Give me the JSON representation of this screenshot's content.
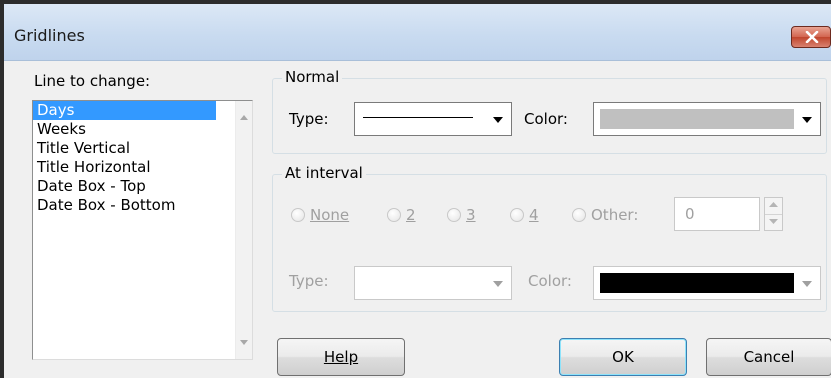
{
  "window": {
    "title": "Gridlines"
  },
  "line_to_change": {
    "label": "Line to change:",
    "items": [
      "Days",
      "Weeks",
      "Title Vertical",
      "Title Horizontal",
      "Date Box - Top",
      "Date Box - Bottom"
    ],
    "selected_index": 0
  },
  "normal": {
    "group_label": "Normal",
    "type_label": "Type:",
    "color_label": "Color:",
    "color_value": "#c0c0c0"
  },
  "at_interval": {
    "group_label": "At interval",
    "options": [
      "None",
      "2",
      "3",
      "4",
      "Other:"
    ],
    "other_value": "0",
    "type_label": "Type:",
    "color_label": "Color:",
    "color_value": "#000000"
  },
  "buttons": {
    "help": "Help",
    "ok": "OK",
    "cancel": "Cancel"
  },
  "icons": {
    "close": "close-icon",
    "dropdown": "chevron-down-icon",
    "scroll_up": "scroll-up-arrow-icon",
    "scroll_down": "scroll-down-arrow-icon"
  }
}
